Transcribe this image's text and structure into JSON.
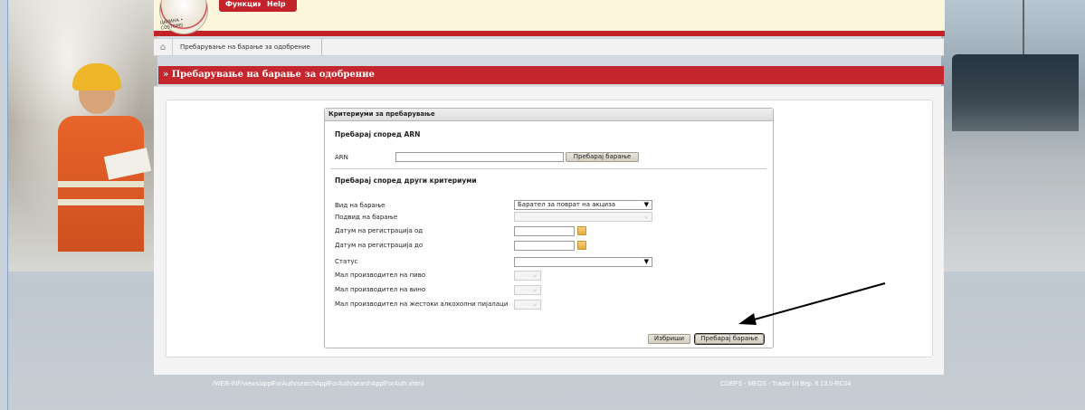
{
  "header": {
    "logo_text": "ЦАРИНА • CUSTOMS",
    "btn_functions": "Функции",
    "btn_help": "Help"
  },
  "breadcrumb": {
    "item": "Пребарување на барање за одобрение"
  },
  "page_title": "» Пребарување на барање за одобрение",
  "form": {
    "header": "Критериуми за пребарување",
    "section_arn": "Пребарај според ARN",
    "arn_label": "ARN",
    "arn_value": "",
    "arn_search_button": "Пребарај барање",
    "section_other": "Пребарај според други критериуми",
    "fields": {
      "request_type_label": "Вид на барање",
      "request_type_value": "Барател за поврат на акциза",
      "request_subtype_label": "Подвид на барање",
      "request_subtype_value": "",
      "reg_date_from_label": "Датум на регистрација од",
      "reg_date_to_label": "Датум на регистрација до",
      "status_label": "Статус",
      "status_value": "",
      "small_beer_label": "Мал производител на пиво",
      "small_wine_label": "Мал производител на вино",
      "small_spirits_label": "Мал производител на жестоки алкохолни пијалаци"
    },
    "clear_button": "Избриши",
    "search_button": "Пребарај барање"
  },
  "footer": {
    "path": "/WEB-INF/views/applForAuth/searchApplForAuth/searchApplForAuth.xhtml",
    "version": "CDEPS - MEOS - Trader UI Вер. 6.13.0-RC04"
  },
  "colors": {
    "accent_red": "#c4262d",
    "header_bg": "#fbf6dc"
  }
}
